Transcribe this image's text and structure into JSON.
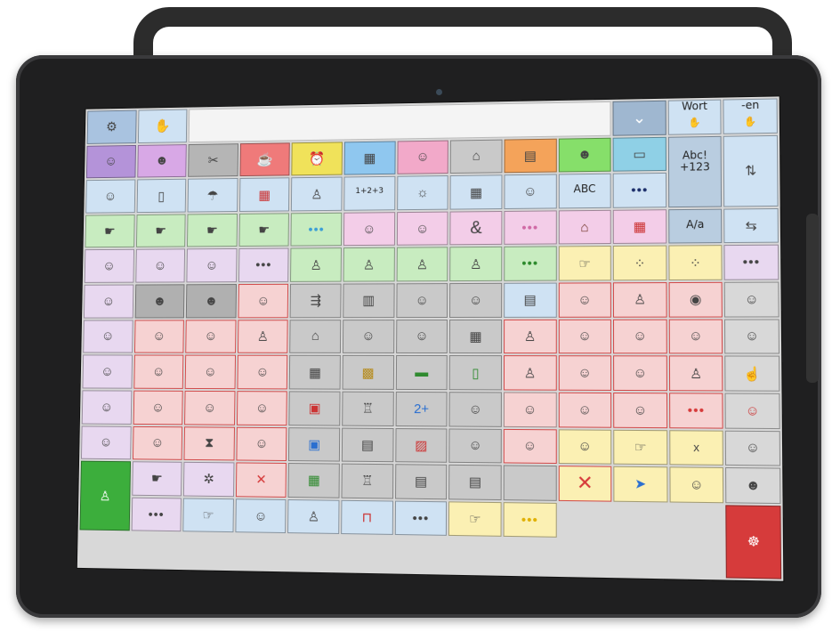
{
  "screen": {
    "top_row": {
      "settings_label": "",
      "mode_label": "",
      "collapse_label": "",
      "word_label": "Wort",
      "suffix_label": "-en",
      "abc_label": "Abc!\n+123",
      "keyboard_label": "ABC",
      "case_label": "A/a",
      "numbers_label": "1+2+3",
      "ampersand_label": "&",
      "x_label": "x",
      "more_label": "•••"
    },
    "colors": {
      "pronoun": "#e8d8f0",
      "verb": "#f6d2d2",
      "noun": "#c9c9c9",
      "adjective": "#fbf0b3",
      "category": "#cfe2f3",
      "green": "#c8ecc0",
      "go_green": "#3cae3c",
      "stop_red": "#d63b3b"
    }
  }
}
